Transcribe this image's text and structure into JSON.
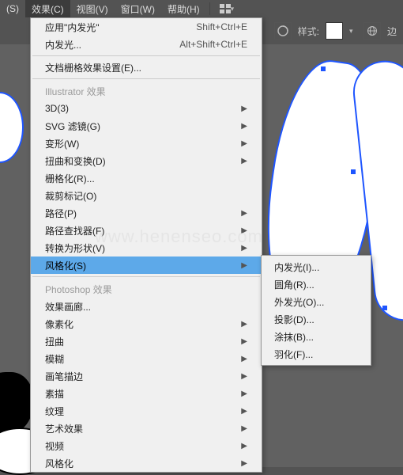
{
  "menubar": {
    "items": [
      {
        "label": "(S)"
      },
      {
        "label": "效果(C)"
      },
      {
        "label": "视图(V)"
      },
      {
        "label": "窗口(W)"
      },
      {
        "label": "帮助(H)"
      }
    ]
  },
  "toolbar": {
    "style_label": "样式:",
    "advanced_label": "边"
  },
  "menu": {
    "apply_last": "应用\"内发光\"",
    "apply_last_shortcut": "Shift+Ctrl+E",
    "inner_glow": "内发光...",
    "inner_glow_shortcut": "Alt+Shift+Ctrl+E",
    "doc_raster_settings": "文档栅格效果设置(E)...",
    "illustrator_header": "Illustrator 效果",
    "illustrator": [
      {
        "label": "3D(3)",
        "arrow": true
      },
      {
        "label": "SVG 滤镜(G)",
        "arrow": true
      },
      {
        "label": "变形(W)",
        "arrow": true
      },
      {
        "label": "扭曲和变换(D)",
        "arrow": true
      },
      {
        "label": "栅格化(R)...",
        "arrow": false
      },
      {
        "label": "裁剪标记(O)",
        "arrow": false
      },
      {
        "label": "路径(P)",
        "arrow": true
      },
      {
        "label": "路径查找器(F)",
        "arrow": true
      },
      {
        "label": "转换为形状(V)",
        "arrow": true
      },
      {
        "label": "风格化(S)",
        "arrow": true,
        "highlighted": true
      }
    ],
    "photoshop_header": "Photoshop 效果",
    "photoshop": [
      {
        "label": "效果画廊...",
        "arrow": false
      },
      {
        "label": "像素化",
        "arrow": true
      },
      {
        "label": "扭曲",
        "arrow": true
      },
      {
        "label": "模糊",
        "arrow": true
      },
      {
        "label": "画笔描边",
        "arrow": true
      },
      {
        "label": "素描",
        "arrow": true
      },
      {
        "label": "纹理",
        "arrow": true
      },
      {
        "label": "艺术效果",
        "arrow": true
      },
      {
        "label": "视频",
        "arrow": true
      },
      {
        "label": "风格化",
        "arrow": true
      }
    ]
  },
  "submenu": {
    "items": [
      {
        "label": "内发光(I)..."
      },
      {
        "label": "圆角(R)..."
      },
      {
        "label": "外发光(O)..."
      },
      {
        "label": "投影(D)..."
      },
      {
        "label": "涂抹(B)..."
      },
      {
        "label": "羽化(F)..."
      }
    ]
  },
  "watermark": "www.henenseo.com"
}
